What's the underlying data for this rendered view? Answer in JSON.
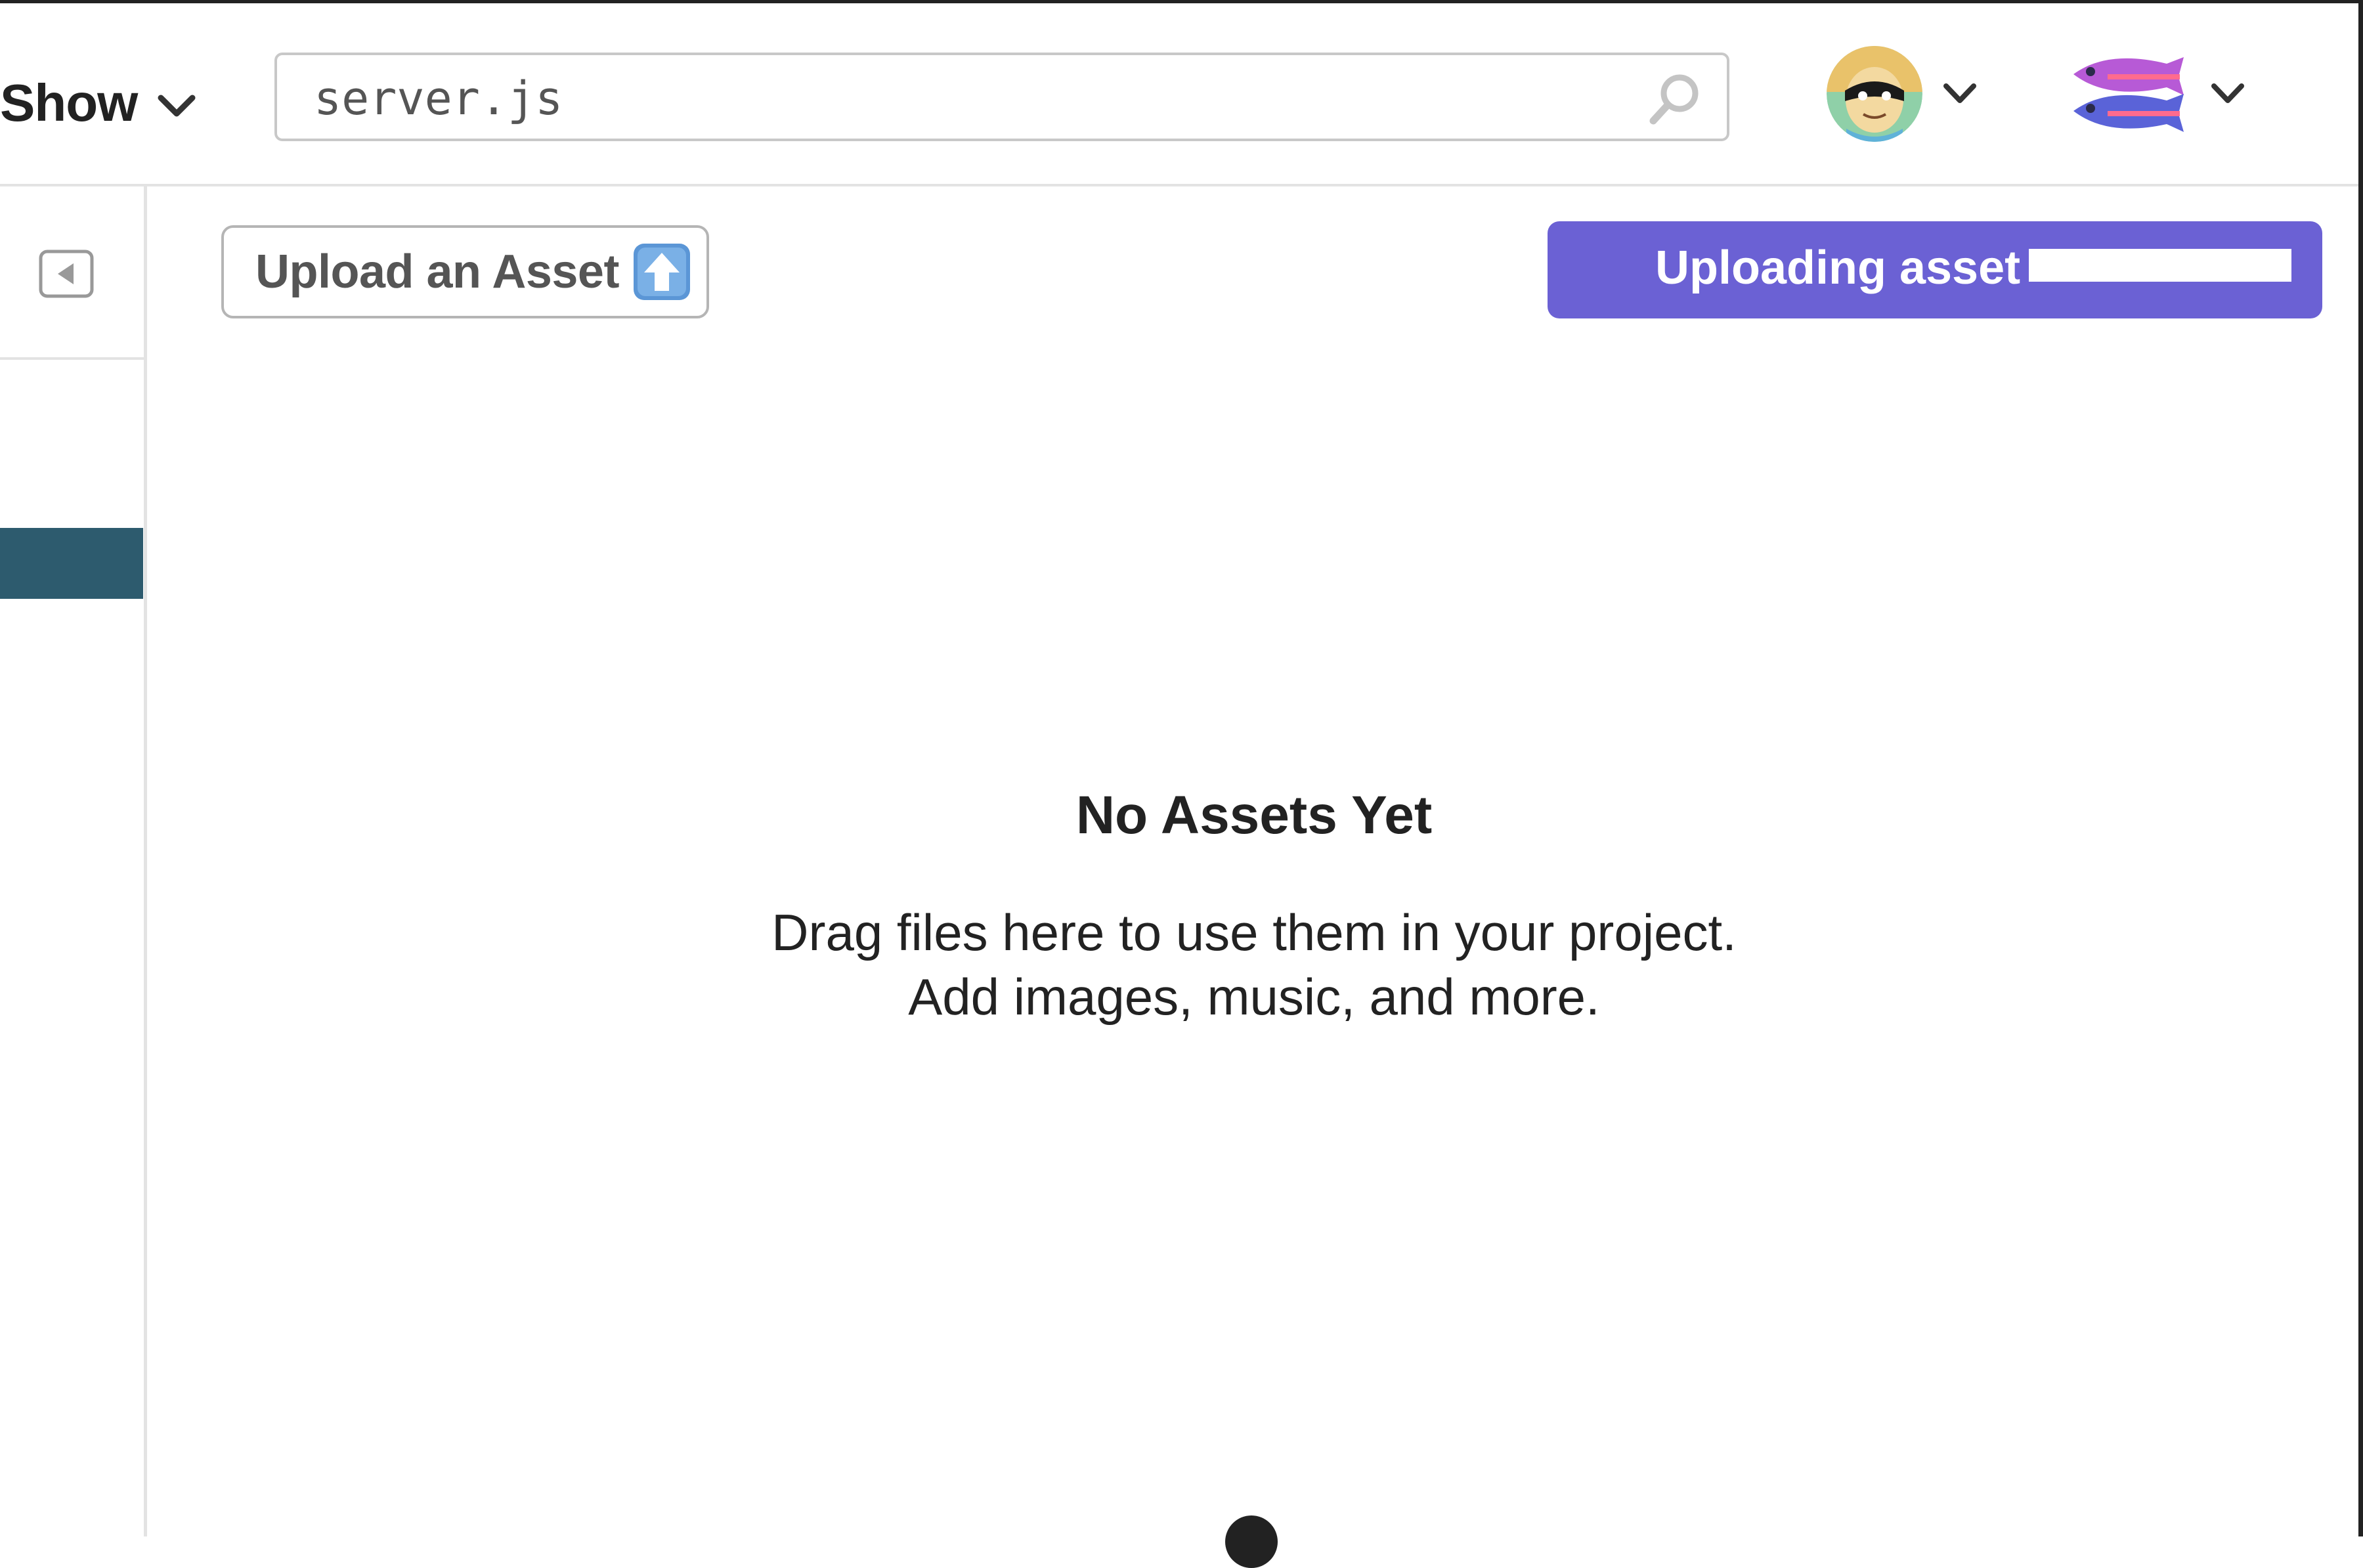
{
  "header": {
    "show_label": "Show",
    "search": {
      "value": "server.js",
      "placeholder": ""
    }
  },
  "icons": {
    "show_dropdown": "chevron-down-icon",
    "search": "search-icon",
    "avatar_dropdown": "chevron-down-icon",
    "team_dropdown": "chevron-down-icon",
    "sidebar_toggle": "collapse-left-icon",
    "upload": "up-arrow-icon"
  },
  "toolbar": {
    "upload_label": "Upload an Asset",
    "uploading_label": "Uploading asset",
    "upload_progress": 1.0
  },
  "empty_state": {
    "title": "No Assets Yet",
    "line1": "Drag files here to use them in your project.",
    "line2": "Add images, music, and more."
  },
  "colors": {
    "accent_purple": "#6b61d4",
    "sidebar_active": "#2d5b6e",
    "border": "#e3e3e3"
  }
}
